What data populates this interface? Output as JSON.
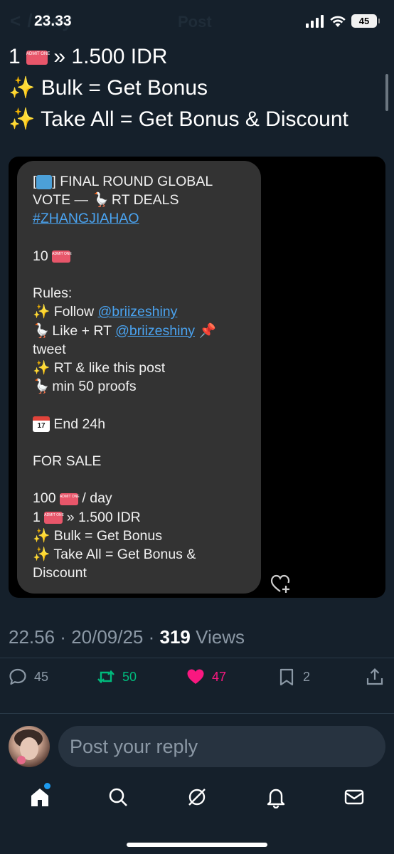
{
  "status": {
    "time": "23.33",
    "battery": "45",
    "ghost_left": "< / day",
    "ghost_right": "Post"
  },
  "tweet": {
    "line1": {
      "qty": "1",
      "ticket": "ADMIT ONE",
      "text": "» 1.500 IDR"
    },
    "line2": {
      "emoji": "✨",
      "text": "Bulk = Get Bonus"
    },
    "line3": {
      "emoji": "✨",
      "text": "Take All = Get Bonus & Discount"
    }
  },
  "image": {
    "l1_prefix": "[",
    "l1_suffix": "] FINAL ROUND GLOBAL",
    "l2": "VOTE — ",
    "l2b": "RT DEALS",
    "hashtag": "#ZHANGJIAHAO",
    "count": "10",
    "rules": "Rules:",
    "r1": "Follow ",
    "r1_handle": "@briizeshiny",
    "r2": "Like + RT ",
    "r2_handle": "@briizeshiny",
    "r2b": "tweet",
    "r3": "RT & like this post",
    "r4": "min 50 proofs",
    "cal_day": "17",
    "end": "End 24h",
    "for_sale": "FOR SALE",
    "s1_qty": "100",
    "s1_text": "/ day",
    "s2_qty": "1",
    "s2_text": "» 1.500 IDR",
    "s3": "Bulk = Get Bonus",
    "s4": "Take All = Get Bonus &",
    "s5": "Discount"
  },
  "meta": {
    "time": "22.56",
    "date": "20/09/25",
    "views_count": "319",
    "views_label": "Views"
  },
  "actions": {
    "replies": "45",
    "retweets": "50",
    "likes": "47",
    "bookmarks": "2"
  },
  "reply": {
    "placeholder": "Post your reply"
  },
  "colors": {
    "background": "#15202b",
    "retweet": "#00ba7c",
    "like": "#f91880",
    "link": "#4aa3f0",
    "accent": "#1d9bf0"
  }
}
